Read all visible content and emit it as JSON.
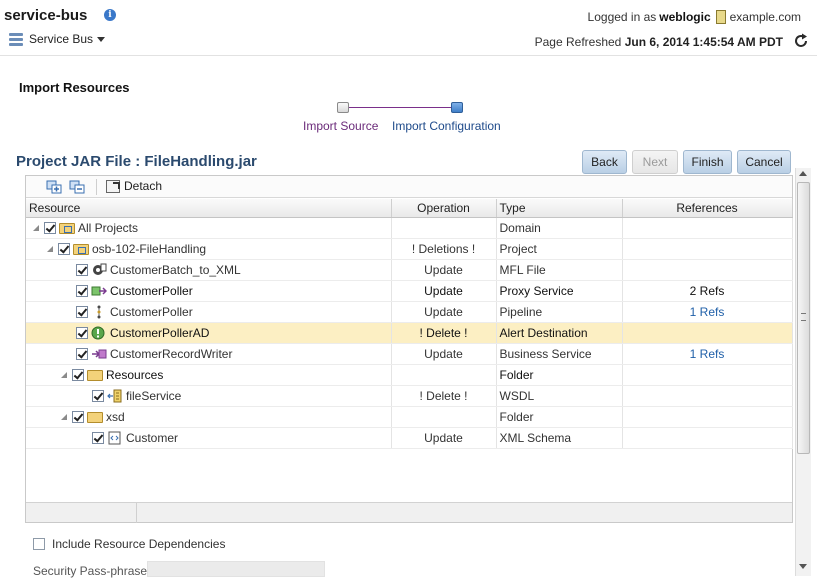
{
  "header": {
    "app_title": "service-bus",
    "menu_label": "Service Bus",
    "logged_in_prefix": "Logged in as",
    "user": "weblogic",
    "domain": "example.com",
    "refreshed_prefix": "Page Refreshed",
    "refreshed_time": "Jun 6, 2014 1:45:54 AM PDT"
  },
  "page": {
    "heading": "Import Resources",
    "train": {
      "step1": "Import Source",
      "step2": "Import Configuration"
    },
    "section_title": "Project JAR File : FileHandling.jar"
  },
  "buttons": {
    "back": "Back",
    "next": "Next",
    "finish": "Finish",
    "cancel": "Cancel"
  },
  "toolbar": {
    "detach": "Detach"
  },
  "table": {
    "columns": [
      "Resource",
      "Operation",
      "Type",
      "References"
    ],
    "rows": [
      {
        "name": "All Projects",
        "operation": "",
        "type": "Domain",
        "refs": ""
      },
      {
        "name": "osb-102-FileHandling",
        "operation": "! Deletions !",
        "type": "Project",
        "refs": ""
      },
      {
        "name": "CustomerBatch_to_XML",
        "operation": "Update",
        "type": "MFL File",
        "refs": ""
      },
      {
        "name": "CustomerPoller",
        "operation": "Update",
        "type": "Proxy Service",
        "refs": "2 Refs"
      },
      {
        "name": "CustomerPoller",
        "operation": "Update",
        "type": "Pipeline",
        "refs": "1 Refs"
      },
      {
        "name": "CustomerPollerAD",
        "operation": "! Delete !",
        "type": "Alert Destination",
        "refs": ""
      },
      {
        "name": "CustomerRecordWriter",
        "operation": "Update",
        "type": "Business Service",
        "refs": "1 Refs"
      },
      {
        "name": "Resources",
        "operation": "",
        "type": "Folder",
        "refs": ""
      },
      {
        "name": "fileService",
        "operation": "! Delete !",
        "type": "WSDL",
        "refs": ""
      },
      {
        "name": "xsd",
        "operation": "",
        "type": "Folder",
        "refs": ""
      },
      {
        "name": "Customer",
        "operation": "Update",
        "type": "XML Schema",
        "refs": ""
      }
    ]
  },
  "form": {
    "include_deps_label": "Include Resource Dependencies",
    "passphrase_label": "Security Pass-phrase"
  },
  "colors": {
    "accent": "#2b4a6e",
    "delete": "#c41a1a",
    "selected_row": "#fcefc3",
    "link": "#1f5fa8"
  }
}
